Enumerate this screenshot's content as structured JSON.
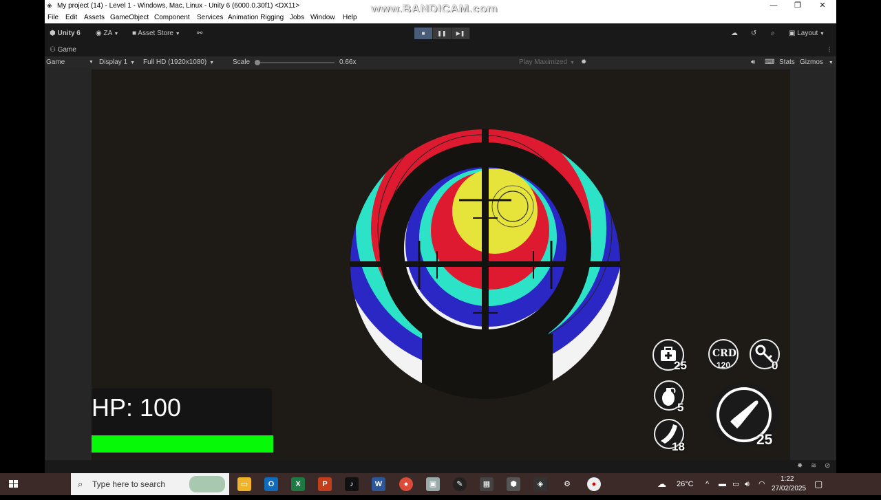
{
  "window": {
    "title": "My project (14) - Level 1 - Windows, Mac, Linux - Unity 6 (6000.0.30f1) <DX11>",
    "watermark": "www.BANDICAM.com",
    "minimize": "—",
    "restore": "❐",
    "close": "✕"
  },
  "menu": [
    "File",
    "Edit",
    "Assets",
    "GameObject",
    "Component",
    "Services",
    "Animation Rigging",
    "Jobs",
    "Window",
    "Help"
  ],
  "toolbar": {
    "unity_label": "Unity 6",
    "account": "ZA",
    "asset_store": "Asset Store",
    "layout": "Layout"
  },
  "tab": {
    "label": "Game"
  },
  "gamebar": {
    "mode": "Game",
    "display": "Display 1",
    "resolution": "Full HD (1920x1080)",
    "scale_label": "Scale",
    "scale_value": "0.66x",
    "play_maximized": "Play Maximized",
    "stats": "Stats",
    "gizmos": "Gizmos"
  },
  "hud": {
    "hp_label": "HP: 100",
    "hp_fraction": 1.0,
    "medkit_count": "25",
    "card_label": "CRD",
    "card_count": "120",
    "key_count": "0",
    "grenade_count": "5",
    "magazine_count": "18",
    "ammo_count": "25"
  },
  "taskbar": {
    "search_placeholder": "Type here to search",
    "temperature": "26°C",
    "time": "1:22",
    "date": "27/02/2025"
  },
  "colors": {
    "editor_bg": "#191919",
    "hp_bar": "#06f906",
    "target_yellow": "#e6e43a",
    "target_red": "#de1a30",
    "target_cyan": "#2de3c7",
    "target_blue": "#2a27c4",
    "taskbar": "#3b2a28"
  }
}
